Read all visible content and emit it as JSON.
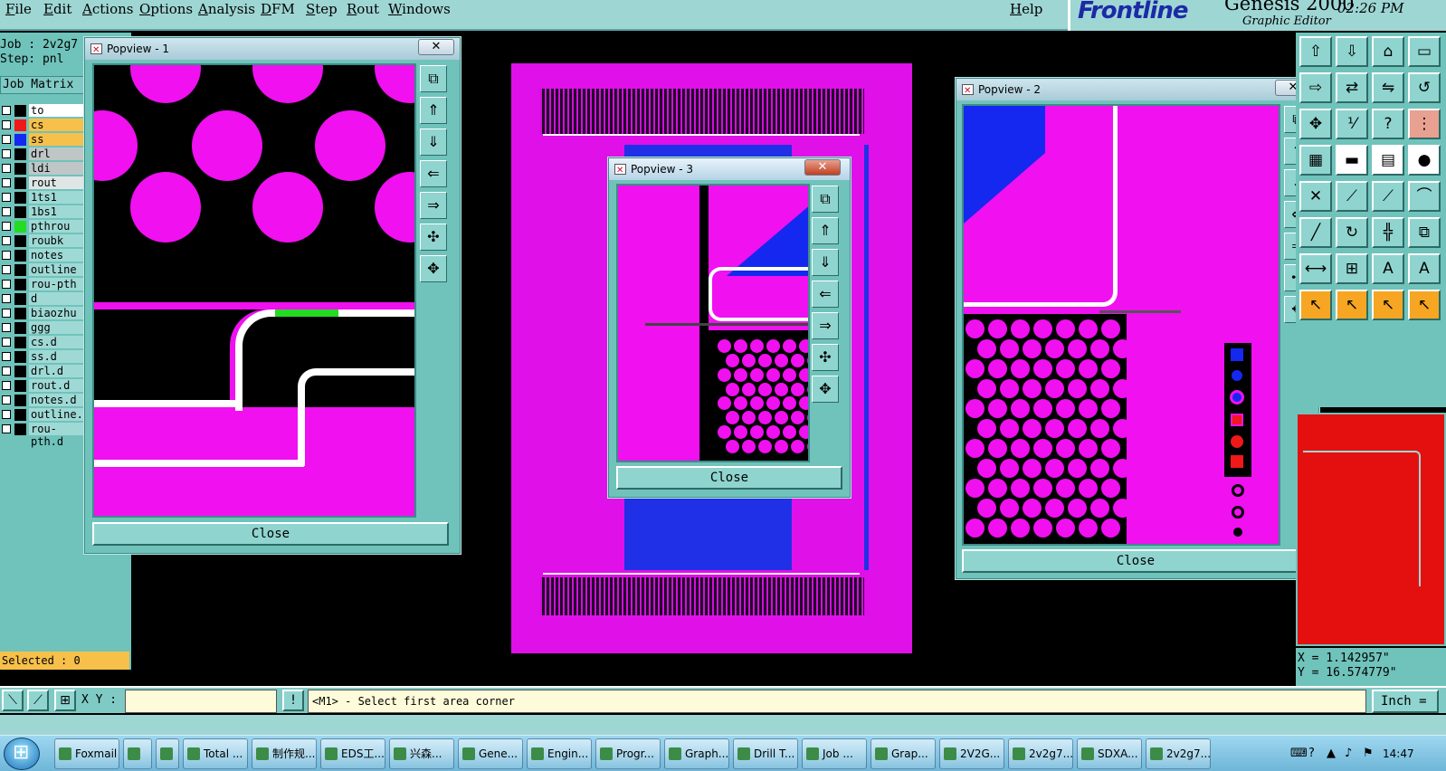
{
  "menu": [
    "File",
    "Edit",
    "Actions",
    "Options",
    "Analysis",
    "DFM",
    "Step",
    "Rout",
    "Windows"
  ],
  "help_label": "Help",
  "brand": {
    "logo": "Frontline",
    "product": "Genesis 2000",
    "subtitle": "Graphic Editor"
  },
  "clock": "02:26 PM",
  "job": {
    "job_line": "Job : 2v2g7",
    "step_line": "Step: pnl"
  },
  "job_matrix_label": "Job Matrix",
  "layers": [
    {
      "name": "to",
      "color": "#000000",
      "bg": "#ffffff"
    },
    {
      "name": "cs",
      "color": "#f01818",
      "bg": "#f6c04a"
    },
    {
      "name": "ss",
      "color": "#1428f0",
      "bg": "#f6c04a"
    },
    {
      "name": "drl",
      "color": "#000000",
      "bg": "#bfc7c6"
    },
    {
      "name": "ldi",
      "color": "#000000",
      "bg": "#bfc7c6"
    },
    {
      "name": "rout",
      "color": "#000000",
      "bg": "#dfe6e5"
    },
    {
      "name": "1ts1",
      "color": "#000000",
      "bg": "#9fd9d5"
    },
    {
      "name": "1bs1",
      "color": "#000000",
      "bg": "#9fd9d5"
    },
    {
      "name": "pthrou",
      "color": "#22dd22",
      "bg": "#9fd9d5"
    },
    {
      "name": "roubk",
      "color": "#000000",
      "bg": "#9fd9d5"
    },
    {
      "name": "notes",
      "color": "#000000",
      "bg": "#9fd9d5"
    },
    {
      "name": "outline",
      "color": "#000000",
      "bg": "#9fd9d5"
    },
    {
      "name": "rou-pth",
      "color": "#000000",
      "bg": "#9fd9d5"
    },
    {
      "name": "d",
      "color": "#000000",
      "bg": "#9fd9d5"
    },
    {
      "name": "biaozhu",
      "color": "#000000",
      "bg": "#9fd9d5"
    },
    {
      "name": "ggg",
      "color": "#000000",
      "bg": "#9fd9d5"
    },
    {
      "name": "cs.d",
      "color": "#000000",
      "bg": "#9fd9d5"
    },
    {
      "name": "ss.d",
      "color": "#000000",
      "bg": "#9fd9d5"
    },
    {
      "name": "drl.d",
      "color": "#000000",
      "bg": "#9fd9d5"
    },
    {
      "name": "rout.d",
      "color": "#000000",
      "bg": "#9fd9d5"
    },
    {
      "name": "notes.d",
      "color": "#000000",
      "bg": "#9fd9d5"
    },
    {
      "name": "outline.d",
      "color": "#000000",
      "bg": "#9fd9d5"
    },
    {
      "name": "rou-pth.d",
      "color": "#000000",
      "bg": "#9fd9d5"
    }
  ],
  "selected": "Selected : 0",
  "popups": {
    "p1": {
      "title": "Popview - 1",
      "close_label": "Close",
      "x_label": "✕"
    },
    "p2": {
      "title": "Popview - 2",
      "close_label": "Close",
      "x_label": "✕"
    },
    "p3": {
      "title": "Popview - 3",
      "close_label": "Close",
      "x_label": "✕"
    }
  },
  "coords": {
    "x": "X =  1.142957\"",
    "y": "Y = 16.574779\""
  },
  "command": {
    "xy_label": "X Y :",
    "xy_value": "",
    "message": "<M1> - Select first area corner",
    "unit": "Inch ="
  },
  "taskbar": {
    "items": [
      "Foxmail",
      "",
      "",
      "Total ...",
      "制作规...",
      "EDS工...",
      "兴森...",
      "Gene...",
      "Engin...",
      "Progr...",
      "Graph...",
      "Drill T...",
      "Job ...",
      "Grap...",
      "2V2G...",
      "2v2g7...",
      "SDXA...",
      "2v2g7..."
    ],
    "time": "14:47"
  },
  "colors": {
    "accent": "#6fc3bb",
    "magenta": "#f010f0",
    "blue": "#1428f0",
    "status": "#f6c04a"
  }
}
